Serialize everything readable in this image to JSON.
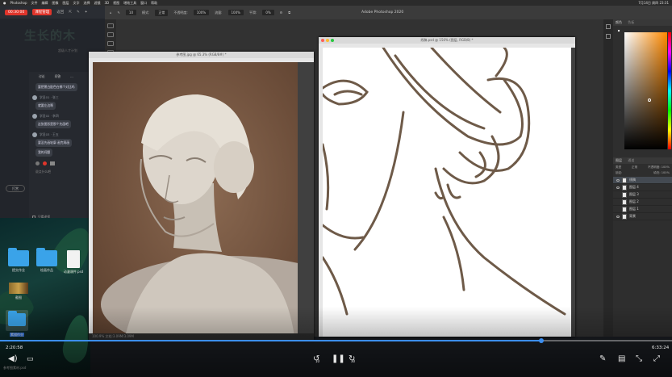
{
  "menubar": {
    "app": "Photoshop",
    "items": [
      "文件",
      "编辑",
      "图像",
      "图层",
      "文字",
      "选择",
      "滤镜",
      "3D",
      "视图",
      "增效工具",
      "窗口",
      "帮助"
    ],
    "clock": "7月14日 周四 23:31"
  },
  "chat": {
    "live_badge": "00:30:00",
    "tab_active": "课程管理",
    "tab2": "返回",
    "watermark": "生长的木",
    "watermark_sub": "超级人才计划",
    "chat_tabs": [
      "讨论",
      "问答",
      "..."
    ],
    "messages": [
      {
        "user": "",
        "text": "要把黑白配色在哪个对比吗"
      },
      {
        "user": "学员01 · 张三",
        "text": "就要左边啊"
      },
      {
        "user": "学员02 · 李四",
        "text": "这张图形是那个先画吧"
      },
      {
        "user": "学员03 · 王五",
        "text": "要没先画轮廓 画完再画"
      },
      {
        "user": "",
        "text": "我的问题"
      }
    ],
    "bottom_hint": "说点什么吧",
    "tip_button": "打赏",
    "checkbox_label": "只看老师",
    "stats": "1% 试题"
  },
  "desktop": {
    "icons": [
      {
        "label": "提交作业"
      },
      {
        "label": "绘画作品"
      },
      {
        "label": "动漫课件.psd"
      },
      {
        "label": "截图"
      },
      {
        "label": "素描作业"
      }
    ],
    "bottom_file": "参考图素材.psd"
  },
  "ps": {
    "app_title": "Adobe Photoshop 2020",
    "mode_label": "模式:",
    "mode_value": "正常",
    "opacity_label": "不透明度:",
    "opacity_value": "100%",
    "flow_label": "流量:",
    "flow_value": "100%",
    "smooth_label": "平滑:",
    "smooth_value": "0%",
    "doc1_title": "参考图.jpg @ 65.3% (RGB/8#) *",
    "doc1_status": "100.9% 文档:3.09M/3.09M",
    "doc2_title": "线稿.psd @ 150% (图层, RGB/8) *",
    "color_tab": "颜色",
    "swatch_tab": "色板",
    "layers_tab": "图层",
    "channels_tab": "通道",
    "kind_label": "类型",
    "normal_label": "正常",
    "opacity_short": "不透明度: 100%",
    "lock_label": "锁定:",
    "fill_label": "填充: 100%",
    "layers": [
      {
        "name": "线稿",
        "selected": true
      },
      {
        "name": "图层 4",
        "selected": false
      },
      {
        "name": "图层 3",
        "selected": false
      },
      {
        "name": "图层 2",
        "selected": false
      },
      {
        "name": "图层 1",
        "selected": false
      },
      {
        "name": "背景",
        "selected": false
      }
    ]
  },
  "video": {
    "current_time": "2:20:58",
    "total_time": "6:33:24",
    "progress": 0.805,
    "rewind_label": "10",
    "forward_label": "30"
  },
  "colors": {
    "accent": "#3c8ef0",
    "live_red": "#e0352b",
    "sketch_line": "#6e5a48",
    "photo_bg": "#7a5a44"
  }
}
